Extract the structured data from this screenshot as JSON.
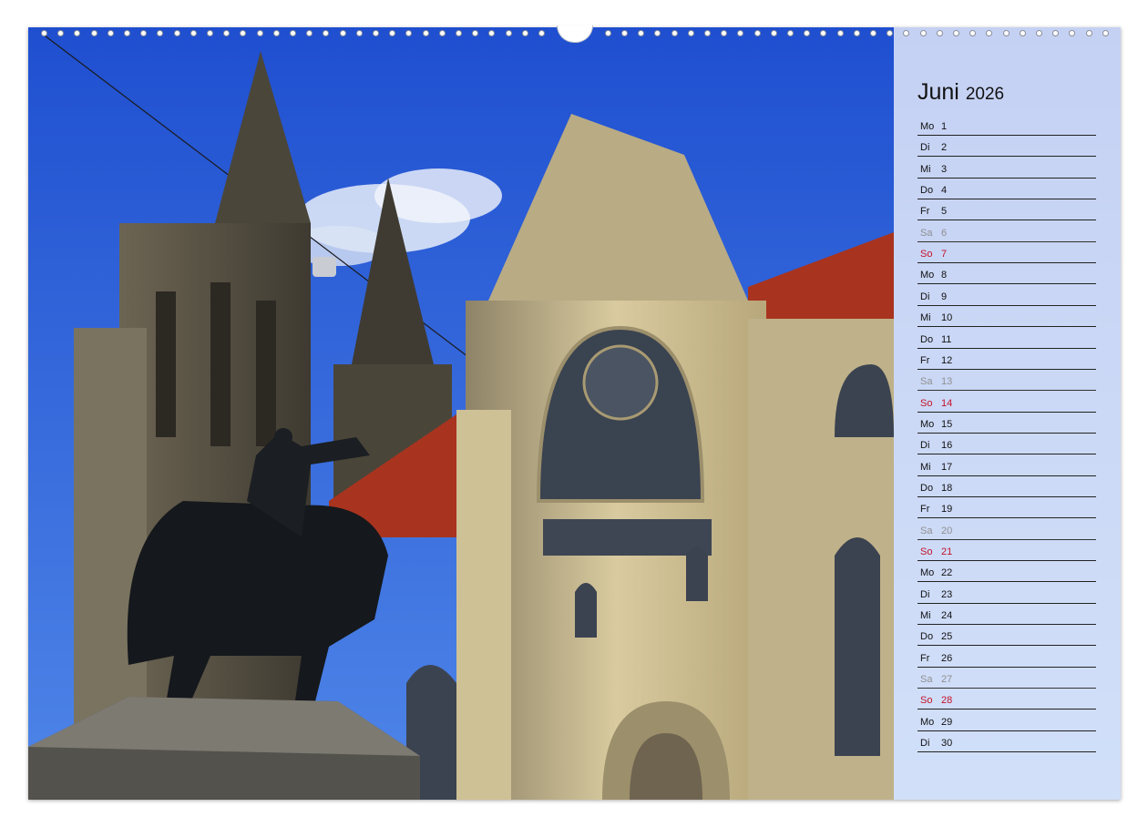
{
  "calendar": {
    "month": "Juni",
    "year": "2026",
    "days": [
      {
        "wd": "Mo",
        "d": "1"
      },
      {
        "wd": "Di",
        "d": "2"
      },
      {
        "wd": "Mi",
        "d": "3"
      },
      {
        "wd": "Do",
        "d": "4"
      },
      {
        "wd": "Fr",
        "d": "5"
      },
      {
        "wd": "Sa",
        "d": "6"
      },
      {
        "wd": "So",
        "d": "7"
      },
      {
        "wd": "Mo",
        "d": "8"
      },
      {
        "wd": "Di",
        "d": "9"
      },
      {
        "wd": "Mi",
        "d": "10"
      },
      {
        "wd": "Do",
        "d": "11"
      },
      {
        "wd": "Fr",
        "d": "12"
      },
      {
        "wd": "Sa",
        "d": "13"
      },
      {
        "wd": "So",
        "d": "14"
      },
      {
        "wd": "Mo",
        "d": "15"
      },
      {
        "wd": "Di",
        "d": "16"
      },
      {
        "wd": "Mi",
        "d": "17"
      },
      {
        "wd": "Do",
        "d": "18"
      },
      {
        "wd": "Fr",
        "d": "19"
      },
      {
        "wd": "Sa",
        "d": "20"
      },
      {
        "wd": "So",
        "d": "21"
      },
      {
        "wd": "Mo",
        "d": "22"
      },
      {
        "wd": "Di",
        "d": "23"
      },
      {
        "wd": "Mi",
        "d": "24"
      },
      {
        "wd": "Do",
        "d": "25"
      },
      {
        "wd": "Fr",
        "d": "26"
      },
      {
        "wd": "Sa",
        "d": "27"
      },
      {
        "wd": "So",
        "d": "28"
      },
      {
        "wd": "Mo",
        "d": "29"
      },
      {
        "wd": "Di",
        "d": "30"
      }
    ]
  },
  "colors": {
    "sky": "#2f63d8",
    "sunday": "#c4122a",
    "saturday": "#8f8f8f",
    "roof": "#a8341f",
    "stone": "#c7b98f"
  }
}
